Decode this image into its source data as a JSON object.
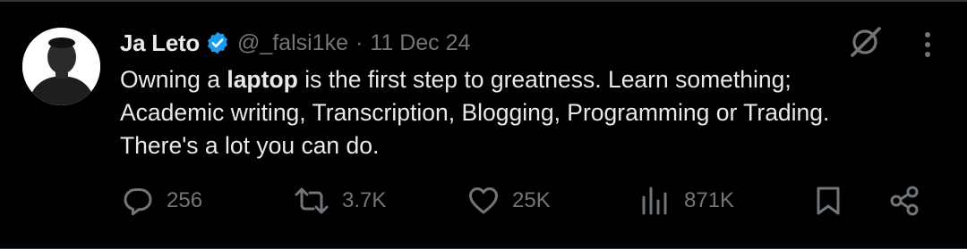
{
  "tweet": {
    "author_name": "Ja Leto",
    "handle": "@_falsi1ke",
    "separator": "·",
    "date": "11 Dec 24",
    "text_parts": [
      "Owning a ",
      "laptop",
      " is the first step to greatness. Learn something;",
      "Academic writing, Transcription, Blogging, Programming or Trading.",
      "There's a lot you can do."
    ]
  },
  "actions": {
    "reply_count": "256",
    "repost_count": "3.7K",
    "like_count": "25K",
    "views_count": "871K"
  },
  "icons": {
    "verified": "verified-badge-icon",
    "grok": "grok-icon",
    "more": "more-vertical-icon",
    "reply": "reply-icon",
    "repost": "repost-icon",
    "like": "heart-icon",
    "views": "views-icon",
    "bookmark": "bookmark-icon",
    "share": "share-icon"
  },
  "colors": {
    "background": "#000000",
    "text_primary": "#e7e9ea",
    "text_secondary": "#71767b",
    "verified_blue": "#1d9bf0",
    "border": "#2f3336"
  }
}
